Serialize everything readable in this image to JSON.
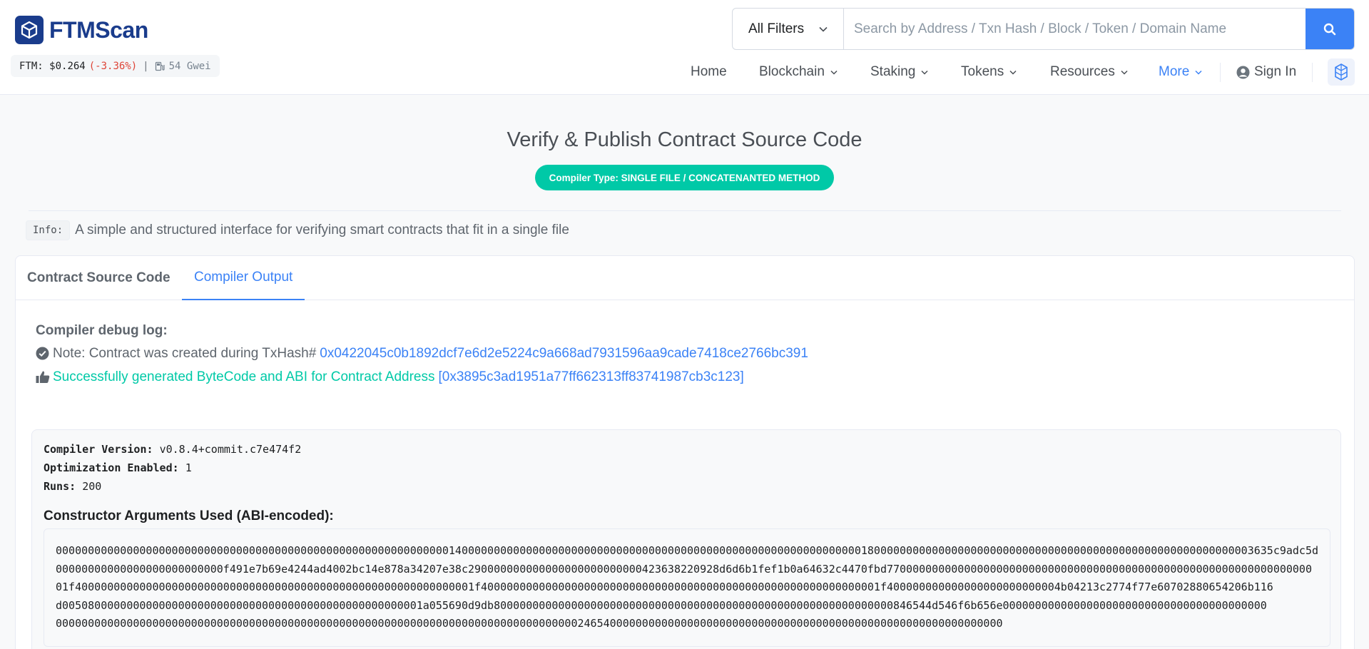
{
  "brand": {
    "name": "FTMScan",
    "accent": "#1a3c8c"
  },
  "ticker": {
    "label": "FTM:",
    "price": "$0.264",
    "change": "(-3.36%)",
    "separator": "|",
    "gas": "54 Gwei"
  },
  "search": {
    "filter_label": "All Filters",
    "placeholder": "Search by Address / Txn Hash / Block / Token / Domain Name"
  },
  "nav": {
    "items": [
      {
        "label": "Home"
      },
      {
        "label": "Blockchain"
      },
      {
        "label": "Staking"
      },
      {
        "label": "Tokens"
      },
      {
        "label": "Resources"
      },
      {
        "label": "More"
      }
    ],
    "sign_in": "Sign In"
  },
  "page": {
    "title": "Verify & Publish Contract Source Code",
    "badge": "Compiler Type: SINGLE FILE / CONCATENANTED METHOD",
    "info_label": "Info:",
    "info_text": "A simple and structured interface for verifying smart contracts that fit in a single file"
  },
  "tabs": [
    {
      "label": "Contract Source Code",
      "active": false
    },
    {
      "label": "Compiler Output",
      "active": true
    }
  ],
  "debug": {
    "title": "Compiler debug log:",
    "note_prefix": "Note: Contract was created during TxHash#",
    "tx_hash": "0x0422045c0b1892dcf7e6d2e5224c9a668ad7931596aa9cade7418ce2766bc391",
    "success_text": "Successfully generated ByteCode and ABI for Contract Address",
    "contract_address": "[0x3895c3ad1951a77ff662313ff83741987cb3c123]"
  },
  "compiler": {
    "version_label": "Compiler Version:",
    "version": "v0.8.4+commit.c7e474f2",
    "optimization_label": "Optimization Enabled:",
    "optimization": "1",
    "runs_label": "Runs:",
    "runs": "200",
    "args_title": "Constructor Arguments Used (ABI-encoded):",
    "args_lines": [
      "000000000000000000000000000000000000000000000000000000000000014000000000000000000000000000000000000000000000000000000000000001800000000000000000000000000000000000000000000000000000000003635c9adc5dea000",
      "00000000000000000000000000f491e7b69e4244ad4002bc14e878a34207e38c290000000000000000000000000423638220928d6d6b1fef1b0a64632c4470fbd770000000000000000000000000000000000000000000000000000000000000000",
      "01f40000000000000000000000000000000000000000000000000000000000001f40000000000000000000000000000000000000000000000000000000000001f400000000000000000000000004b04213c2774f77e60702880654206b116",
      "d00508000000000000000000000000000000000000000000000000001a055690d9db80000000000000000000000000000000000000000000000000000000000000846544d546f6b656e00000000000000000000000000000000000000000",
      "000000000000000000000000000000000000000000000000000000000000000000000000000000000246540000000000000000000000000000000000000000000000000000000000000"
    ]
  }
}
